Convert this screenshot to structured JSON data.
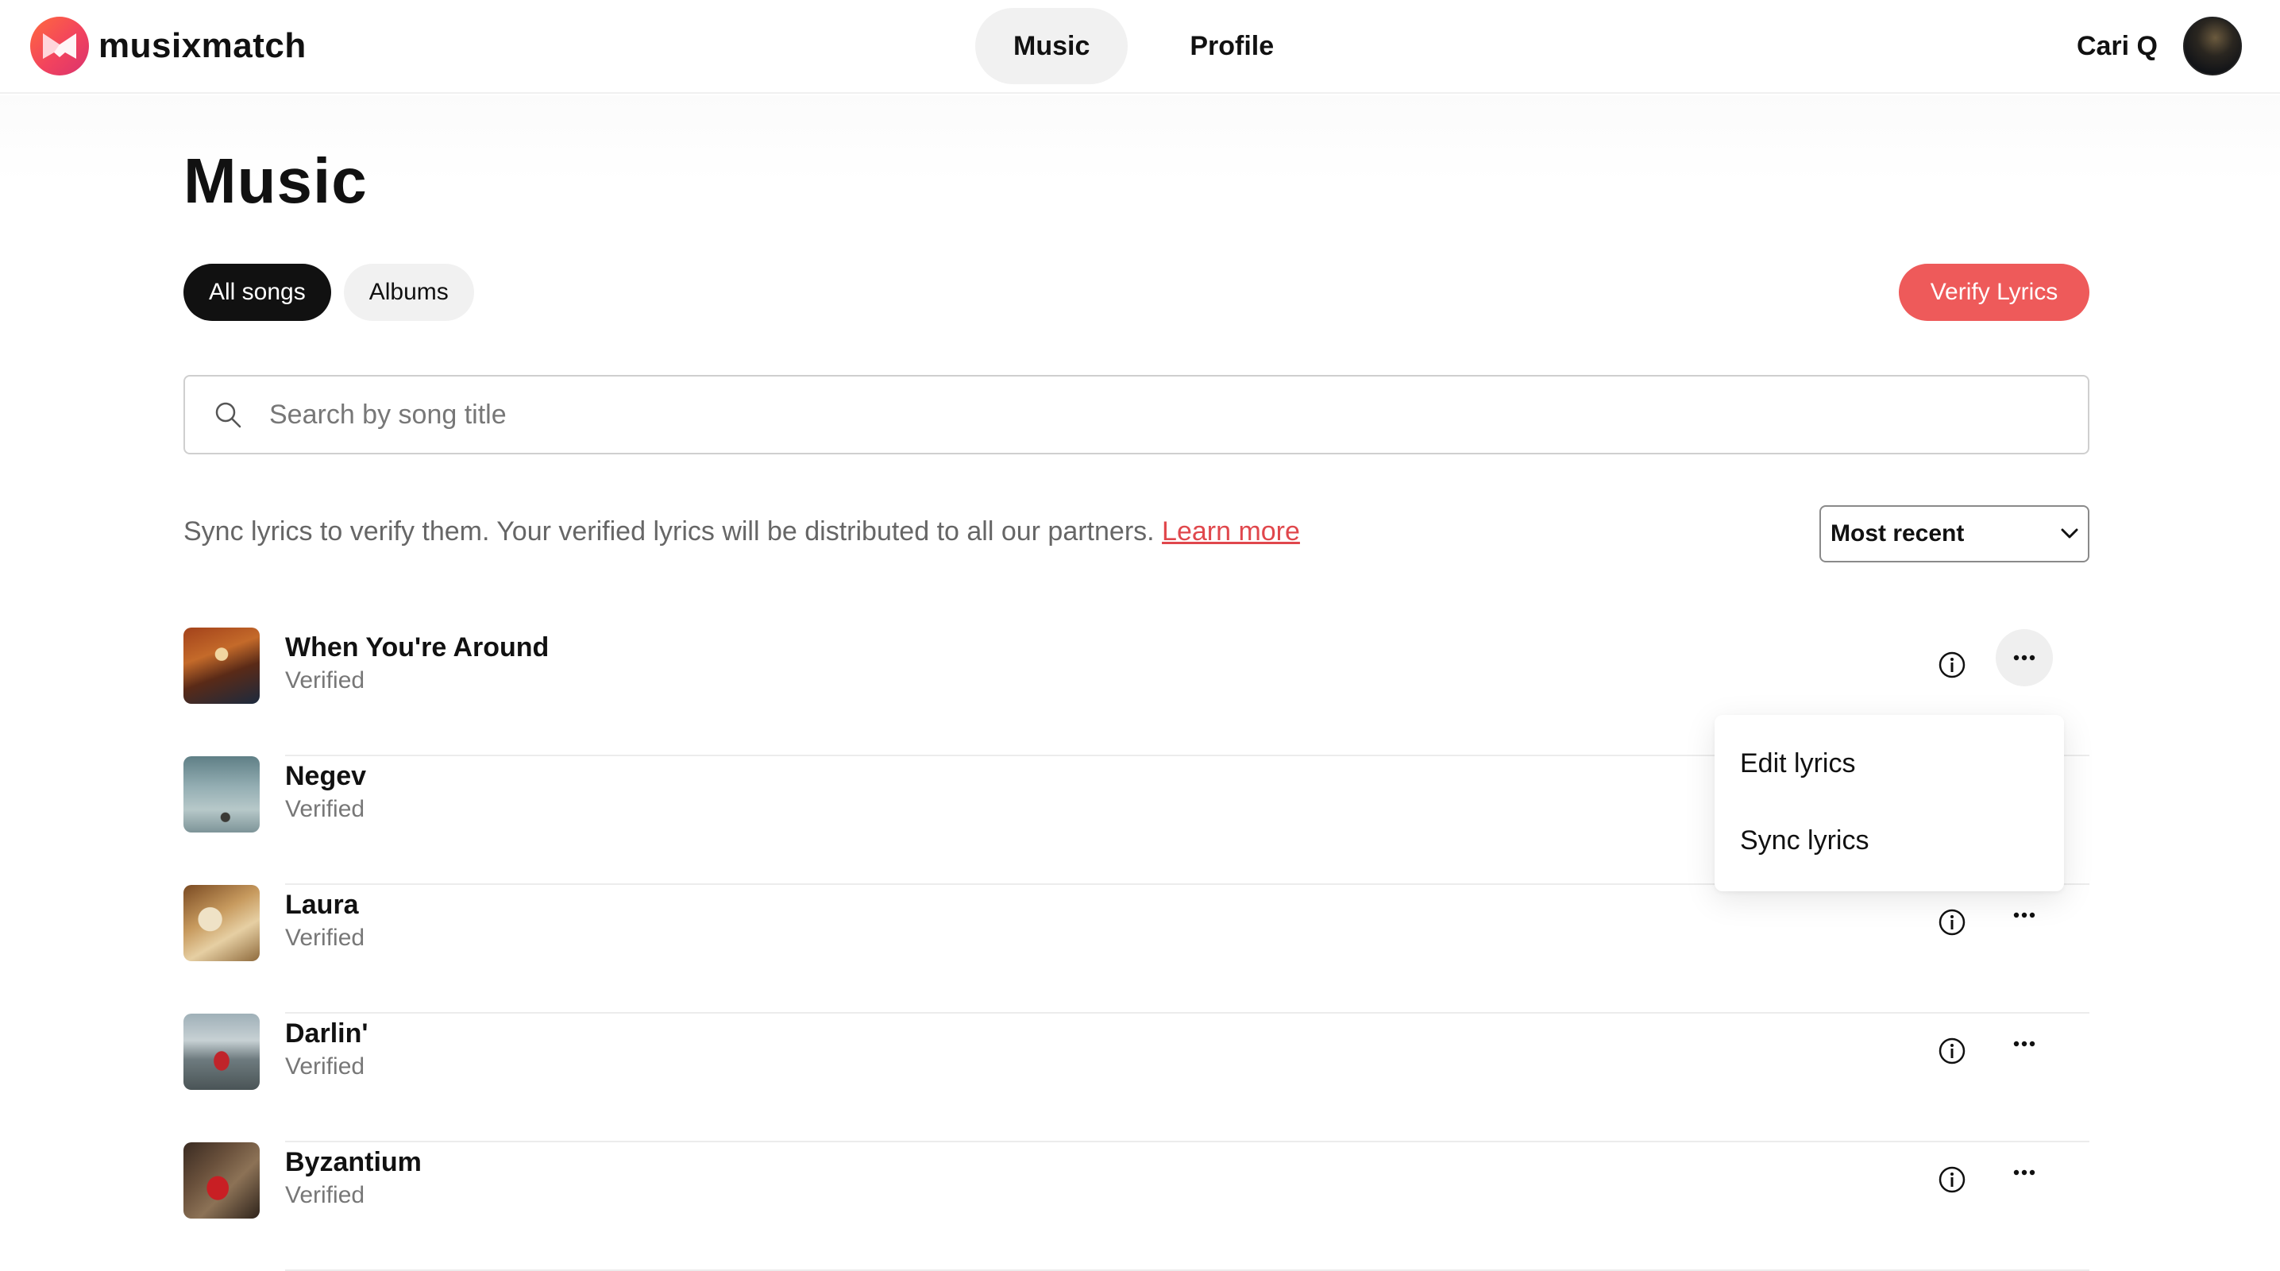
{
  "header": {
    "brand": "musixmatch",
    "nav": [
      {
        "label": "Music",
        "active": true
      },
      {
        "label": "Profile",
        "active": false
      }
    ],
    "user_name": "Cari Q"
  },
  "page": {
    "title": "Music",
    "tabs": [
      {
        "label": "All songs",
        "active": true
      },
      {
        "label": "Albums",
        "active": false
      }
    ],
    "verify_button": "Verify Lyrics",
    "search_placeholder": "Search by song title",
    "info_text": "Sync lyrics to verify them. Your verified lyrics will be distributed to all our partners.",
    "learn_more": "Learn more",
    "sort": {
      "selected": "Most recent"
    }
  },
  "songs": [
    {
      "title": "When You're Around",
      "status": "Verified"
    },
    {
      "title": "Negev",
      "status": "Verified"
    },
    {
      "title": "Laura",
      "status": "Verified"
    },
    {
      "title": "Darlin'",
      "status": "Verified"
    },
    {
      "title": "Byzantium",
      "status": "Verified"
    }
  ],
  "context_menu": {
    "items": [
      "Edit lyrics",
      "Sync lyrics"
    ]
  },
  "colors": {
    "accent": "#ee5a5a",
    "link": "#e0474c",
    "active_chip": "#111111"
  }
}
